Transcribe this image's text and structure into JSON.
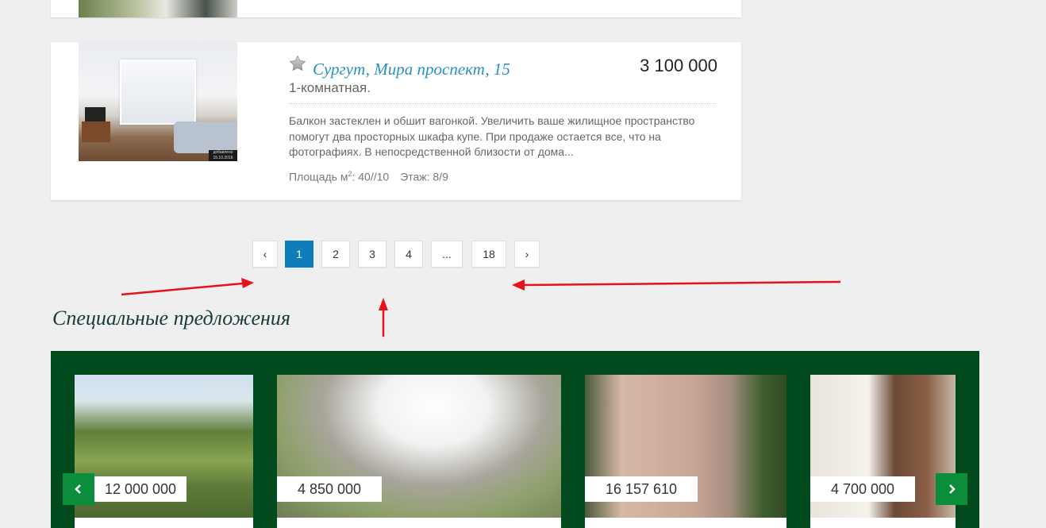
{
  "listing": {
    "title": "Сургут, Мира проспект, 15",
    "price": "3 100 000",
    "rooms": "1-комнатная.",
    "description": "Балкон застеклен и обшит вагонкой. Увеличить ваше жилищное пространство помогут два просторных шкафа купе. При продаже остается все, что на фотографиях. В непосредственной близости от дома...",
    "area_label": "Площадь м",
    "area_sup": "2",
    "area_value": ": 40//10",
    "floor": "Этаж: 8/9",
    "photo_stamp": "добавлено 15.10.2016"
  },
  "pagination": {
    "prev": "‹",
    "pages": [
      "1",
      "2",
      "3",
      "4",
      "...",
      "18"
    ],
    "active": "1",
    "next": "›"
  },
  "special_offers": {
    "title": "Специальные предложения",
    "prices": [
      "12 000 000",
      "4 850 000",
      "16 157 610",
      "4 700 000"
    ]
  },
  "icons": {
    "favorite": "star-icon",
    "prev": "chevron-left-icon",
    "next": "chevron-right-icon"
  },
  "colors": {
    "link": "#2a8fc4",
    "pagination_active": "#0e7dba",
    "offers_background": "#004a1e",
    "carousel_arrow": "#0b8d3c",
    "annotation": "#e8101a"
  }
}
